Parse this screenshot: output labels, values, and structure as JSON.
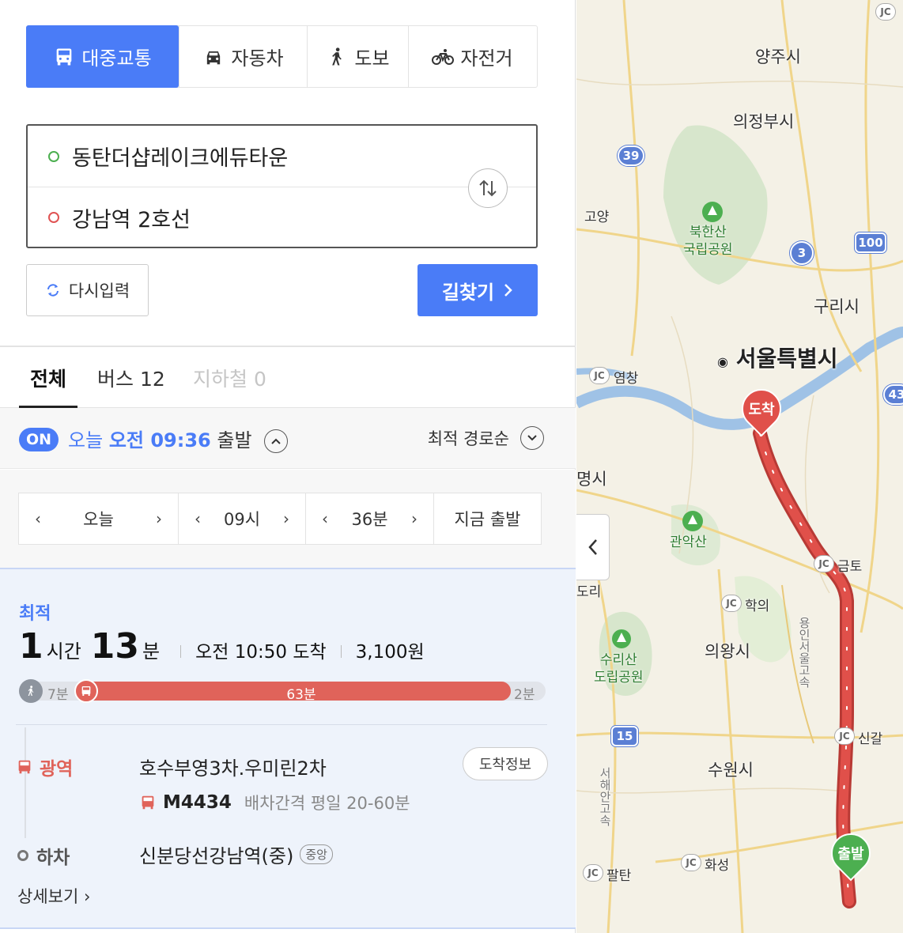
{
  "modes": [
    {
      "label": "대중교통",
      "icon": "bus-icon",
      "active": true
    },
    {
      "label": "자동차",
      "icon": "car-icon",
      "active": false
    },
    {
      "label": "도보",
      "icon": "walk-icon",
      "active": false
    },
    {
      "label": "자전거",
      "icon": "bicycle-icon",
      "active": false
    }
  ],
  "route": {
    "origin": "동탄더샵레이크에듀타운",
    "destination": "강남역 2호선"
  },
  "buttons": {
    "reset": "다시입력",
    "search": "길찾기"
  },
  "tabs": [
    {
      "label": "전체",
      "state": "active"
    },
    {
      "label": "버스 12",
      "state": "normal"
    },
    {
      "label": "지하철 0",
      "state": "disabled"
    }
  ],
  "depart": {
    "badge": "ON",
    "prefix": "오늘",
    "time": "오전 09:36",
    "suffix": "출발",
    "sort_label": "최적 경로순"
  },
  "picker": {
    "day": "오늘",
    "hour": "09시",
    "minute": "36분",
    "now": "지금 출발"
  },
  "result": {
    "best_label": "최적",
    "hours": "1",
    "hours_unit": "시간",
    "minutes": "13",
    "minutes_unit": "분",
    "arrival": "오전 10:50 도착",
    "fare": "3,100원",
    "segments": {
      "walk_start": "7분",
      "bus": "63분",
      "walk_end": "2분"
    },
    "board": {
      "type_label": "광역",
      "stop": "호수부영3차.우미린2차",
      "arrival_info": "도착정보",
      "bus_number": "M4434",
      "interval": "배차간격 평일 20-60분"
    },
    "alight": {
      "label": "하차",
      "stop": "신분당선강남역(중)",
      "tag": "중앙"
    },
    "detail_link": "상세보기"
  },
  "map": {
    "labels": {
      "yangju": "양주시",
      "uijeongbu": "의정부시",
      "goyang": "고양",
      "bukhansan": "북한산",
      "national_park": "국립공원",
      "guri": "구리시",
      "seoul": "서울특별시",
      "yeomchang": "염창",
      "gwangmyeong": "명시",
      "gwanaksan": "관악산",
      "geumto": "금토",
      "dori": "도리",
      "hakui": "학의",
      "uiwang": "의왕시",
      "surisan": "수리산",
      "provincial_park": "도립공원",
      "yongin_seoul_expwy": "용인서울고속",
      "singal": "신갈",
      "suwon": "수원시",
      "seohaean_expwy": "서해안고속",
      "hwaseong": "화성",
      "paltan": "팔탄"
    },
    "shields": [
      "39",
      "3",
      "100",
      "15",
      "43"
    ],
    "jc": "JC",
    "markers": {
      "arrive": "도착",
      "depart": "출발"
    },
    "colors": {
      "route": "#e0504a",
      "depart_marker": "#4caf50",
      "arrive_marker": "#e0504a",
      "river": "#9fc2e6",
      "park": "#cfe3c6"
    }
  }
}
